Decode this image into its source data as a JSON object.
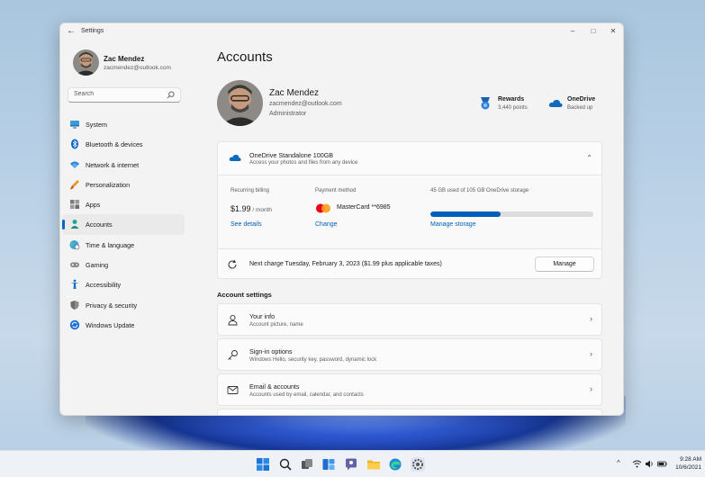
{
  "window": {
    "app_title": "Settings",
    "back": "←",
    "minimize": "–",
    "maximize": "□",
    "close": "✕"
  },
  "profile": {
    "name": "Zac Mendez",
    "email": "zacmendez@outlook.com",
    "role": "Administrator"
  },
  "search": {
    "placeholder": "Search"
  },
  "sidebar": {
    "items": [
      {
        "label": "System",
        "icon": "monitor-icon"
      },
      {
        "label": "Bluetooth & devices",
        "icon": "bluetooth-icon"
      },
      {
        "label": "Network & internet",
        "icon": "wifi-icon"
      },
      {
        "label": "Personalization",
        "icon": "brush-icon"
      },
      {
        "label": "Apps",
        "icon": "apps-icon"
      },
      {
        "label": "Accounts",
        "icon": "person-icon",
        "active": true
      },
      {
        "label": "Time & language",
        "icon": "globe-clock-icon"
      },
      {
        "label": "Gaming",
        "icon": "gamepad-icon"
      },
      {
        "label": "Accessibility",
        "icon": "accessibility-icon"
      },
      {
        "label": "Privacy & security",
        "icon": "shield-icon"
      },
      {
        "label": "Windows Update",
        "icon": "update-icon"
      }
    ]
  },
  "main": {
    "page_title": "Accounts",
    "rewards": {
      "title": "Rewards",
      "sub": "3,440 points"
    },
    "onedrive": {
      "title": "OneDrive",
      "sub": "Backed up"
    },
    "subscription": {
      "title": "OneDrive Standalone 100GB",
      "desc": "Access your photos and files from any device",
      "billing_label": "Recurring billing",
      "price": "$1.99",
      "price_period": " / month",
      "see_details": "See details",
      "payment_label": "Payment method",
      "card": "MasterCard **6985",
      "change": "Change",
      "storage_label": "45 GB used of 105 GB OneDrive storage",
      "storage_used_fraction": 0.43,
      "manage_storage": "Manage storage",
      "next_charge": "Next charge Tuesday, February 3, 2023 ($1.99 plus applicable taxes)",
      "manage": "Manage"
    },
    "section_title": "Account settings",
    "rows": [
      {
        "title": "Your info",
        "desc": "Account picture, name",
        "icon": "person-outline-icon"
      },
      {
        "title": "Sign-in options",
        "desc": "Windows Hello, security key, password, dynamic lock",
        "icon": "key-icon"
      },
      {
        "title": "Email & accounts",
        "desc": "Accounts used by email, calendar, and contacts",
        "icon": "mail-icon"
      }
    ]
  },
  "taskbar": {
    "time": "9:28 AM",
    "date": "10/6/2021"
  },
  "colors": {
    "accent": "#005fb8",
    "window_bg": "#f3f3f3",
    "card_bg": "#fbfbfb"
  }
}
